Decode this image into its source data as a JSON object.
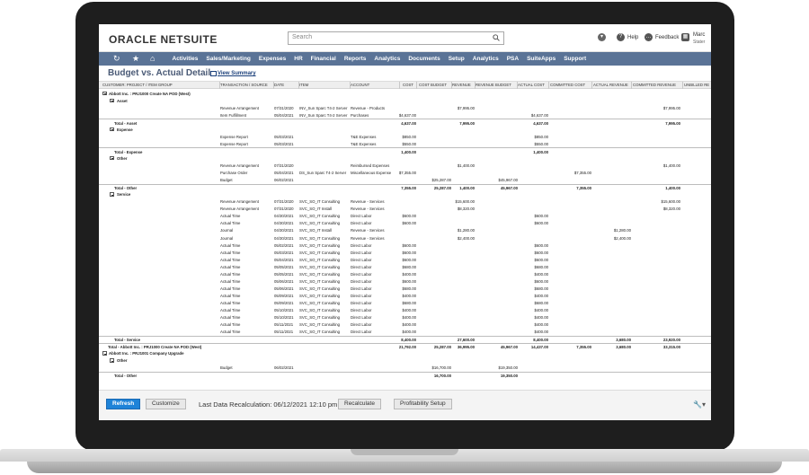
{
  "header": {
    "logo_part1": "ORACLE",
    "logo_part2": "NETSUITE",
    "search_placeholder": "Search",
    "help": "Help",
    "feedback": "Feedback",
    "user_name": "Marc",
    "user_role": "Stater"
  },
  "nav": {
    "items": [
      "Activities",
      "Sales/Marketing",
      "Expenses",
      "HR",
      "Financial",
      "Reports",
      "Analytics",
      "Documents",
      "Setup",
      "Analytics",
      "PSA",
      "SuiteApps",
      "Support"
    ]
  },
  "page": {
    "title": "Budget vs. Actual Detail",
    "view_summary": "View Summary"
  },
  "report": {
    "columns": [
      "CUSTOMER: PROJECT / ITEM GROUP",
      "TRANSACTION / SOURCE",
      "DATE",
      "ITEM",
      "ACCOUNT",
      "COST",
      "COST BUDGET",
      "REVENUE",
      "REVENUE BUDGET",
      "ACTUAL COST",
      "COMMITTED COST",
      "ACTUAL REVENUE",
      "COMMITTED REVENUE",
      "UNBILLED RE"
    ],
    "rows": [
      {
        "kind": "group1",
        "label": "Abbott Inc. : PRJ1000 Create NA POD (West)"
      },
      {
        "kind": "group2",
        "label": "Asset"
      },
      {
        "kind": "data",
        "cells": [
          "",
          "Revenue Arrangement",
          "07/31/2020",
          "INV_Sun Sparc T4-2 Server",
          "Revenue - Products",
          "",
          "",
          "$7,995.00",
          "",
          "",
          "",
          "",
          "$7,995.00",
          ""
        ]
      },
      {
        "kind": "data",
        "cells": [
          "",
          "Item Fulfillment",
          "05/04/2021",
          "INV_Sun Sparc T4-2 Server",
          "Purchases",
          "$4,637.00",
          "",
          "",
          "",
          "$4,637.00",
          "",
          "",
          "",
          ""
        ]
      },
      {
        "kind": "total",
        "cells": [
          "Total - Asset",
          "",
          "",
          "",
          "",
          "4,637.00",
          "",
          "7,995.00",
          "",
          "4,637.00",
          "",
          "",
          "7,995.00",
          ""
        ]
      },
      {
        "kind": "group2",
        "label": "Expense"
      },
      {
        "kind": "data",
        "cells": [
          "",
          "Expense Report",
          "05/03/2021",
          "",
          "T&E Expenses",
          "$850.00",
          "",
          "",
          "",
          "$850.00",
          "",
          "",
          "",
          ""
        ]
      },
      {
        "kind": "data",
        "cells": [
          "",
          "Expense Report",
          "05/03/2021",
          "",
          "T&E Expenses",
          "$550.00",
          "",
          "",
          "",
          "$550.00",
          "",
          "",
          "",
          ""
        ]
      },
      {
        "kind": "total",
        "cells": [
          "Total - Expense",
          "",
          "",
          "",
          "",
          "1,400.00",
          "",
          "",
          "",
          "1,400.00",
          "",
          "",
          "",
          ""
        ]
      },
      {
        "kind": "group2",
        "label": "Other"
      },
      {
        "kind": "data",
        "cells": [
          "",
          "Revenue Arrangement",
          "07/31/2020",
          "",
          "Reimbursed Expenses",
          "",
          "",
          "$1,400.00",
          "",
          "",
          "",
          "",
          "$1,400.00",
          ""
        ]
      },
      {
        "kind": "data",
        "cells": [
          "",
          "Purchase Order",
          "05/04/2021",
          "DS_Sun Sparc T4-2 Server",
          "Miscellaneous Expense",
          "$7,355.00",
          "",
          "",
          "",
          "",
          "$7,355.00",
          "",
          "",
          ""
        ]
      },
      {
        "kind": "data",
        "cells": [
          "",
          "Budget",
          "06/02/2021",
          "",
          "",
          "",
          "$25,287.00",
          "",
          "$45,967.00",
          "",
          "",
          "",
          "",
          ""
        ]
      },
      {
        "kind": "total",
        "cells": [
          "Total - Other",
          "",
          "",
          "",
          "",
          "7,355.00",
          "25,287.00",
          "1,400.00",
          "45,967.00",
          "",
          "7,355.00",
          "",
          "1,400.00",
          ""
        ]
      },
      {
        "kind": "group2",
        "label": "Service"
      },
      {
        "kind": "data",
        "cells": [
          "",
          "Revenue Arrangement",
          "07/31/2020",
          "SVC_SO_IT Consulting",
          "Revenue - Services",
          "",
          "",
          "$15,600.00",
          "",
          "",
          "",
          "",
          "$15,600.00",
          ""
        ]
      },
      {
        "kind": "data",
        "cells": [
          "",
          "Revenue Arrangement",
          "07/31/2020",
          "SVC_SO_IT Install",
          "Revenue - Services",
          "",
          "",
          "$8,320.00",
          "",
          "",
          "",
          "",
          "$8,320.00",
          ""
        ]
      },
      {
        "kind": "data",
        "cells": [
          "",
          "Actual Time",
          "04/30/2021",
          "SVC_SO_IT Consulting",
          "Direct Labor",
          "$600.00",
          "",
          "",
          "",
          "$600.00",
          "",
          "",
          "",
          ""
        ]
      },
      {
        "kind": "data",
        "cells": [
          "",
          "Actual Time",
          "04/30/2021",
          "SVC_SO_IT Consulting",
          "Direct Labor",
          "$600.00",
          "",
          "",
          "",
          "$600.00",
          "",
          "",
          "",
          ""
        ]
      },
      {
        "kind": "data",
        "cells": [
          "",
          "Journal",
          "04/30/2021",
          "SVC_SO_IT Install",
          "Revenue - Services",
          "",
          "",
          "$1,280.00",
          "",
          "",
          "",
          "$1,280.00",
          "",
          ""
        ]
      },
      {
        "kind": "data",
        "cells": [
          "",
          "Journal",
          "04/30/2021",
          "SVC_SO_IT Consulting",
          "Revenue - Services",
          "",
          "",
          "$2,400.00",
          "",
          "",
          "",
          "$2,400.00",
          "",
          ""
        ]
      },
      {
        "kind": "data",
        "cells": [
          "",
          "Actual Time",
          "05/02/2021",
          "SVC_SO_IT Consulting",
          "Direct Labor",
          "$600.00",
          "",
          "",
          "",
          "$600.00",
          "",
          "",
          "",
          ""
        ]
      },
      {
        "kind": "data",
        "cells": [
          "",
          "Actual Time",
          "05/03/2021",
          "SVC_SO_IT Consulting",
          "Direct Labor",
          "$600.00",
          "",
          "",
          "",
          "$600.00",
          "",
          "",
          "",
          ""
        ]
      },
      {
        "kind": "data",
        "cells": [
          "",
          "Actual Time",
          "05/04/2021",
          "SVC_SO_IT Consulting",
          "Direct Labor",
          "$600.00",
          "",
          "",
          "",
          "$600.00",
          "",
          "",
          "",
          ""
        ]
      },
      {
        "kind": "data",
        "cells": [
          "",
          "Actual Time",
          "05/05/2021",
          "SVC_SO_IT Consulting",
          "Direct Labor",
          "$680.00",
          "",
          "",
          "",
          "$680.00",
          "",
          "",
          "",
          ""
        ]
      },
      {
        "kind": "data",
        "cells": [
          "",
          "Actual Time",
          "05/05/2021",
          "SVC_SO_IT Consulting",
          "Direct Labor",
          "$400.00",
          "",
          "",
          "",
          "$400.00",
          "",
          "",
          "",
          ""
        ]
      },
      {
        "kind": "data",
        "cells": [
          "",
          "Actual Time",
          "05/06/2021",
          "SVC_SO_IT Consulting",
          "Direct Labor",
          "$600.00",
          "",
          "",
          "",
          "$600.00",
          "",
          "",
          "",
          ""
        ]
      },
      {
        "kind": "data",
        "cells": [
          "",
          "Actual Time",
          "05/06/2021",
          "SVC_SO_IT Consulting",
          "Direct Labor",
          "$680.00",
          "",
          "",
          "",
          "$680.00",
          "",
          "",
          "",
          ""
        ]
      },
      {
        "kind": "data",
        "cells": [
          "",
          "Actual Time",
          "05/09/2021",
          "SVC_SO_IT Consulting",
          "Direct Labor",
          "$400.00",
          "",
          "",
          "",
          "$400.00",
          "",
          "",
          "",
          ""
        ]
      },
      {
        "kind": "data",
        "cells": [
          "",
          "Actual Time",
          "05/09/2021",
          "SVC_SO_IT Consulting",
          "Direct Labor",
          "$680.00",
          "",
          "",
          "",
          "$680.00",
          "",
          "",
          "",
          ""
        ]
      },
      {
        "kind": "data",
        "cells": [
          "",
          "Actual Time",
          "05/10/2021",
          "SVC_SO_IT Consulting",
          "Direct Labor",
          "$400.00",
          "",
          "",
          "",
          "$400.00",
          "",
          "",
          "",
          ""
        ]
      },
      {
        "kind": "data",
        "cells": [
          "",
          "Actual Time",
          "05/10/2021",
          "SVC_SO_IT Consulting",
          "Direct Labor",
          "$400.00",
          "",
          "",
          "",
          "$400.00",
          "",
          "",
          "",
          ""
        ]
      },
      {
        "kind": "data",
        "cells": [
          "",
          "Actual Time",
          "05/11/2021",
          "SVC_SO_IT Consulting",
          "Direct Labor",
          "$400.00",
          "",
          "",
          "",
          "$400.00",
          "",
          "",
          "",
          ""
        ]
      },
      {
        "kind": "data",
        "cells": [
          "",
          "Actual Time",
          "05/11/2021",
          "SVC_SO_IT Consulting",
          "Direct Labor",
          "$400.00",
          "",
          "",
          "",
          "$400.00",
          "",
          "",
          "",
          ""
        ]
      },
      {
        "kind": "total",
        "cells": [
          "Total - Service",
          "",
          "",
          "",
          "",
          "8,400.00",
          "",
          "27,600.00",
          "",
          "8,400.00",
          "",
          "3,680.00",
          "23,920.00",
          ""
        ]
      },
      {
        "kind": "total1",
        "cells": [
          "Total - Abbott Inc. : PRJ1000 Create NA POD (West)",
          "",
          "",
          "",
          "",
          "21,792.00",
          "25,287.00",
          "36,995.00",
          "45,967.00",
          "14,437.00",
          "7,355.00",
          "3,680.00",
          "33,315.00",
          ""
        ]
      },
      {
        "kind": "group1",
        "label": "Abbott Inc. : PRJ1001 Company Upgrade"
      },
      {
        "kind": "group2",
        "label": "Other"
      },
      {
        "kind": "data",
        "cells": [
          "",
          "Budget",
          "06/02/2021",
          "",
          "",
          "",
          "$16,700.00",
          "",
          "$19,350.00",
          "",
          "",
          "",
          "",
          ""
        ]
      },
      {
        "kind": "total",
        "cells": [
          "Total - Other",
          "",
          "",
          "",
          "",
          "",
          "16,700.00",
          "",
          "19,350.00",
          "",
          "",
          "",
          "",
          ""
        ]
      }
    ]
  },
  "footer": {
    "refresh": "Refresh",
    "customize": "Customize",
    "last_recalc": "Last Data Recalculation: 06/12/2021 12:10 pm",
    "recalculate": "Recalculate",
    "profitability": "Profitability Setup"
  }
}
